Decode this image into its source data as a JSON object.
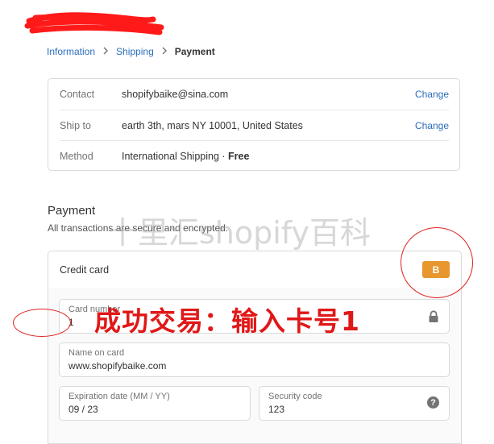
{
  "breadcrumb": {
    "items": [
      "Information",
      "Shipping",
      "Payment"
    ]
  },
  "review": {
    "rows": [
      {
        "label": "Contact",
        "value": "shopifybaike@sina.com",
        "action": "Change"
      },
      {
        "label": "Ship to",
        "value": "earth 3th, mars NY 10001, United States",
        "action": "Change"
      },
      {
        "label": "Method",
        "value": "International Shipping · ",
        "value_strong": "Free"
      }
    ]
  },
  "payment": {
    "title": "Payment",
    "subtitle": "All transactions are secure and encrypted.",
    "method_label": "Credit card",
    "badge": "B",
    "fields": {
      "card_number": {
        "label": "Card number",
        "value": "1"
      },
      "name_on_card": {
        "label": "Name on card",
        "value": "www.shopifybaike.com"
      },
      "expiration": {
        "label": "Expiration date (MM / YY)",
        "value": "09 / 23"
      },
      "security_code": {
        "label": "Security code",
        "value": "123"
      }
    }
  },
  "overlay": {
    "watermark": "十里汇shopify百科",
    "annotation": "成功交易：输入卡号1"
  },
  "colors": {
    "link": "#2a6ebb",
    "badge": "#e8962e",
    "annotation": "#e01818",
    "border": "#d9d9d9"
  },
  "icons": [
    "chevron-right-icon",
    "lock-icon",
    "question-mark-icon"
  ]
}
